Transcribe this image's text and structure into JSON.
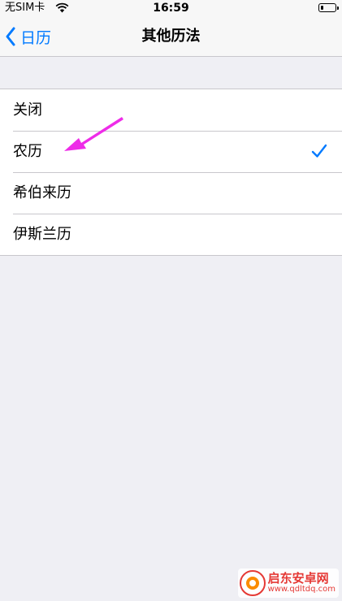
{
  "status_bar": {
    "carrier": "无SIM卡",
    "time": "16:59"
  },
  "nav": {
    "back_label": "日历",
    "title": "其他历法"
  },
  "options": [
    {
      "label": "关闭"
    },
    {
      "label": "农历",
      "selected": true
    },
    {
      "label": "希伯来历"
    },
    {
      "label": "伊斯兰历"
    }
  ],
  "watermark": {
    "name": "启东安卓网",
    "url": "www.qdltdq.com"
  },
  "colors": {
    "accent": "#007aff",
    "annotation": "#ee2ce8",
    "background": "#efeff4"
  }
}
